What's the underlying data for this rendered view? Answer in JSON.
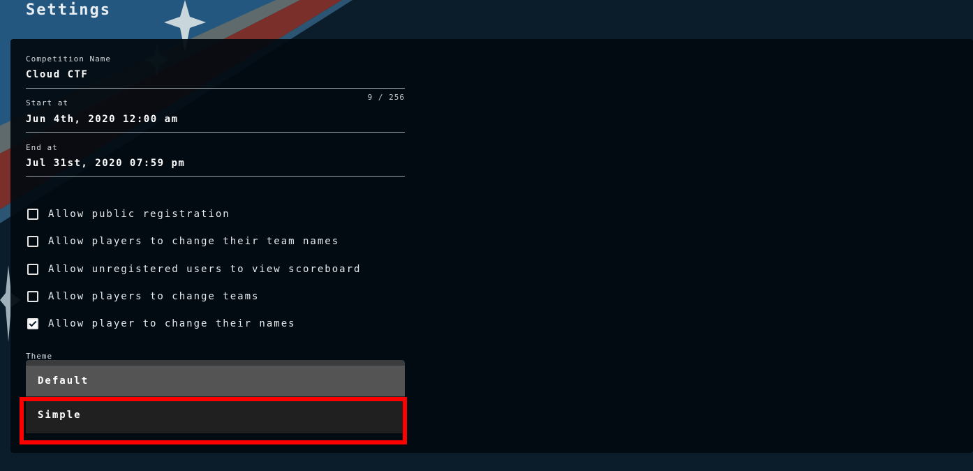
{
  "page": {
    "title": "Settings"
  },
  "form": {
    "competition_name": {
      "label": "Competition Name",
      "value": "Cloud CTF",
      "counter": "9 / 256"
    },
    "start_at": {
      "label": "Start at",
      "value": "Jun 4th, 2020 12:00 am"
    },
    "end_at": {
      "label": "End at",
      "value": "Jul 31st, 2020 07:59 pm"
    },
    "checkboxes": [
      {
        "label": "Allow public registration",
        "checked": false
      },
      {
        "label": "Allow players to change their team names",
        "checked": false
      },
      {
        "label": "Allow unregistered users to view scoreboard",
        "checked": false
      },
      {
        "label": "Allow players to change teams",
        "checked": false
      },
      {
        "label": "Allow player to change their names",
        "checked": true
      }
    ],
    "theme": {
      "label": "Theme",
      "options": [
        "Default",
        "Simple"
      ],
      "highlighted": "Simple"
    }
  },
  "colors": {
    "background": "#0b1c2b",
    "panel": "#020a10",
    "highlight_border": "#ff0000",
    "stripe_blue": "#2d5f86",
    "stripe_red": "#6e2c28",
    "stripe_gray": "#5b6b6c"
  },
  "icons": {
    "checkmark": "check-icon",
    "sparkle": "star-sparkle-icon"
  }
}
